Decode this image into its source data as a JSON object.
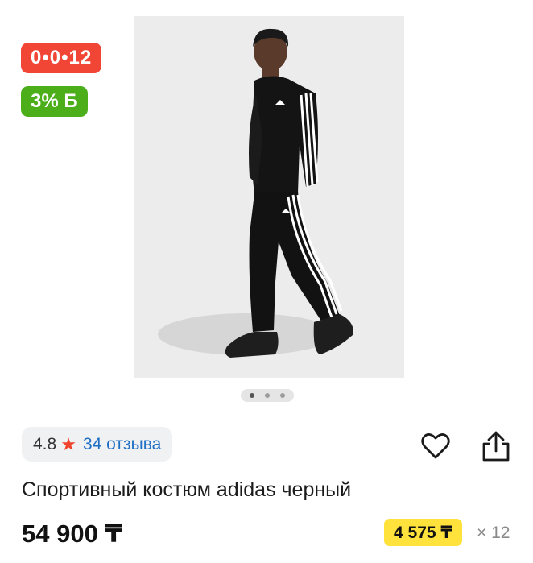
{
  "badges": {
    "installment": "0•0•12",
    "bonus": "3% Б"
  },
  "gallery": {
    "dots": 3,
    "active": 0
  },
  "rating": {
    "score": "4.8",
    "reviews": "34 отзыва"
  },
  "icons": {
    "favorite": "heart-icon",
    "share": "share-icon",
    "star": "star-icon"
  },
  "product": {
    "title": "Спортивный костюм adidas черный",
    "price": "54 900 ₸"
  },
  "installment": {
    "amount": "4 575 ₸",
    "months": "× 12"
  },
  "colors": {
    "red_badge": "#f14635",
    "green_badge": "#4caf1a",
    "installment_badge": "#ffe23b",
    "star": "#f0442d",
    "link": "#1f6fc5"
  }
}
